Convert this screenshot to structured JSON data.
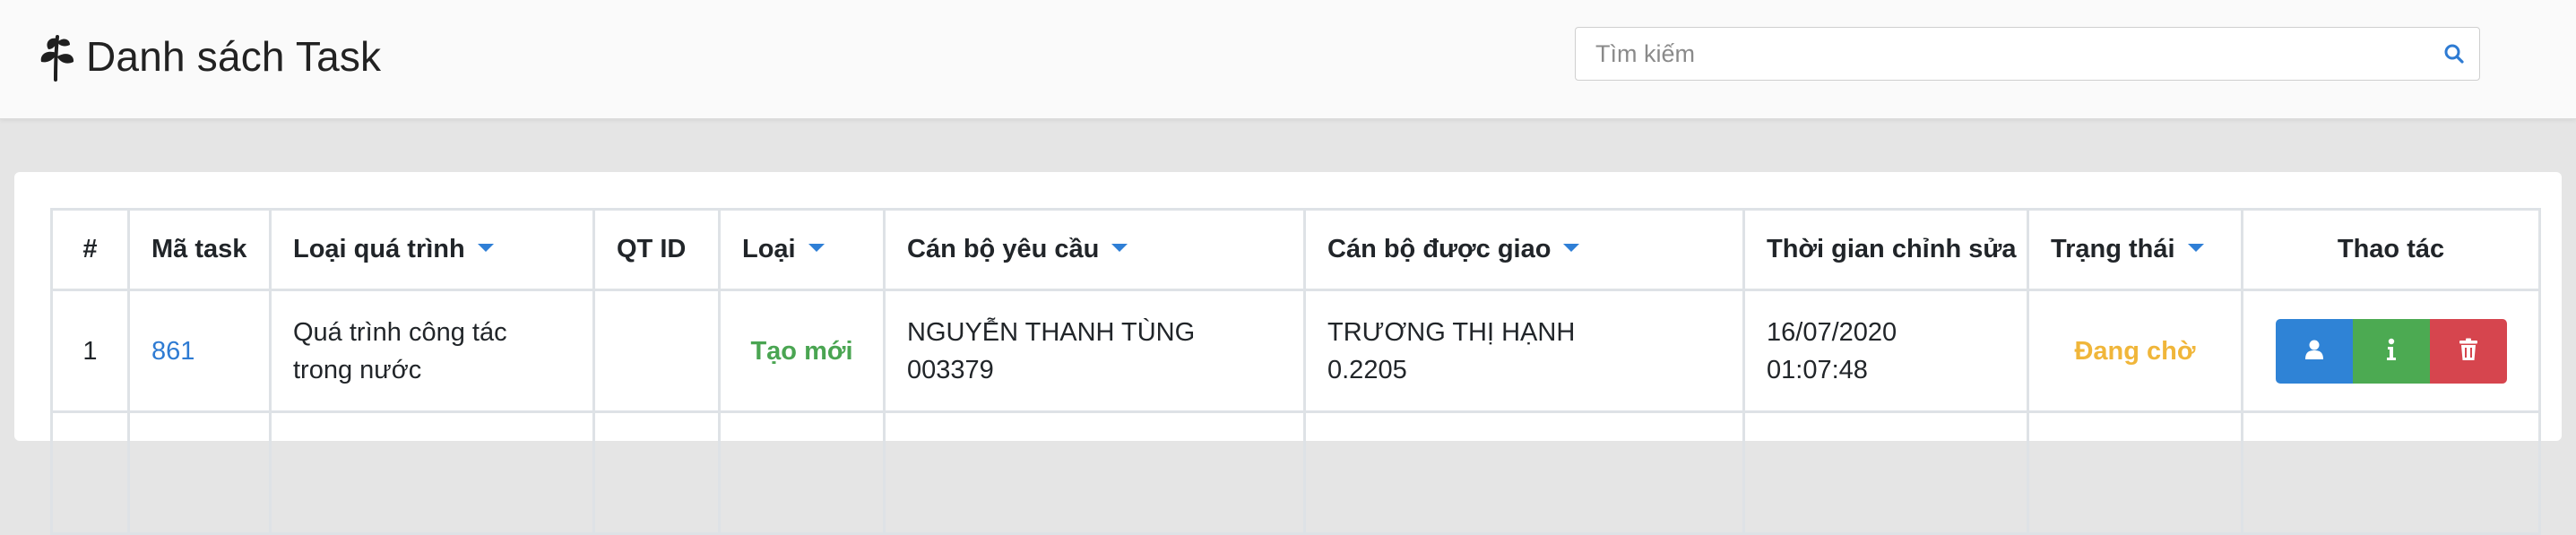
{
  "header": {
    "title": "Danh sách Task",
    "logo_icon": "leaf-branch-icon",
    "search": {
      "placeholder": "Tìm kiếm",
      "value": "",
      "icon": "search-icon"
    }
  },
  "table": {
    "columns": [
      {
        "label": "#",
        "sortable": false
      },
      {
        "label": "Mã task",
        "sortable": false
      },
      {
        "label": "Loại quá trình",
        "sortable": true
      },
      {
        "label": "QT ID",
        "sortable": false
      },
      {
        "label": "Loại",
        "sortable": true
      },
      {
        "label": "Cán bộ yêu cầu",
        "sortable": true
      },
      {
        "label": "Cán bộ được giao",
        "sortable": true
      },
      {
        "label": "Thời gian chỉnh sửa",
        "sortable": false
      },
      {
        "label": "Trạng thái",
        "sortable": true
      },
      {
        "label": "Thao tác",
        "sortable": false
      }
    ],
    "rows": [
      {
        "index": "1",
        "task_code": "861",
        "process_type_line1": "Quá trình công tác",
        "process_type_line2": "trong nước",
        "process_id": "",
        "type": "Tạo mới",
        "requester_name": "NGUYỄN THANH TÙNG",
        "requester_id": "003379",
        "assignee_name": "TRƯƠNG THỊ HẠNH",
        "assignee_id": "0.2205",
        "modified_date": "16/07/2020",
        "modified_time": "01:07:48",
        "status": "Đang chờ",
        "actions": [
          "user-icon",
          "info-icon",
          "trash-icon"
        ]
      }
    ]
  },
  "colors": {
    "link": "#2e7bd3",
    "type_green": "#4aa552",
    "status_amber": "#f0b63a",
    "btn_blue": "#2f83d6",
    "btn_green": "#4caa52",
    "btn_red": "#d6454e",
    "caret": "#2f7fd6"
  }
}
